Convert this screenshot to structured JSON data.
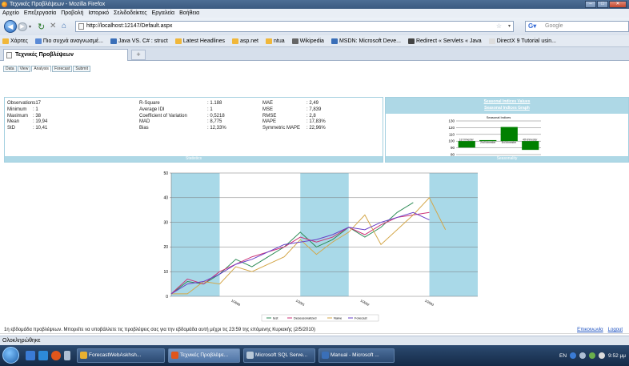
{
  "window": {
    "title": "Τεχνικές Προβλέψεων - Mozilla Firefox"
  },
  "menu": [
    "Αρχείο",
    "Επεξεργασία",
    "Προβολή",
    "Ιστορικό",
    "Σελιδοδείκτες",
    "Εργαλεία",
    "Βοήθεια"
  ],
  "nav": {
    "url": "http://localhost:12147/Default.aspx",
    "search_placeholder": "Google"
  },
  "bookmarks": [
    {
      "label": "Χάρτες",
      "color": "#f0b73a"
    },
    {
      "label": "Πιο συχνά αναγνωσμέ...",
      "color": "#5a8ad6"
    },
    {
      "label": "Java VS. C# : struct",
      "color": "#3a6fb8"
    },
    {
      "label": "Latest Headlines",
      "color": "#f0b73a"
    },
    {
      "label": "asp.net",
      "color": "#f0b73a"
    },
    {
      "label": "ntua",
      "color": "#f0b73a"
    },
    {
      "label": "Wikipedia",
      "color": "#666666"
    },
    {
      "label": "MSDN: Microsoft Deve...",
      "color": "#3a6fb8"
    },
    {
      "label": "Redirect « Servlets « Java",
      "color": "#444444"
    },
    {
      "label": "DirectX 9 Tutorial usin...",
      "color": "#dddddd"
    }
  ],
  "browser_tab": {
    "title": "Τεχνικές Προβλέψεων",
    "new_tab": "+"
  },
  "page_tabs": [
    "Data",
    "View",
    "Analysis",
    "Forecast",
    "Submit"
  ],
  "stats": {
    "col1": [
      {
        "k": "Observations",
        "v": ": 17"
      },
      {
        "k": "Minimum",
        "v": ": 1"
      },
      {
        "k": "Maximum",
        "v": ": 38"
      },
      {
        "k": "Mean",
        "v": ": 19,94"
      },
      {
        "k": "StD",
        "v": ": 10,41"
      }
    ],
    "col2": [
      {
        "k": "R-Square",
        "v": ": 1.188"
      },
      {
        "k": "Average IDI",
        "v": ": 1"
      },
      {
        "k": "Coefficient of Variation",
        "v": ": 0,5218"
      },
      {
        "k": "MAD",
        "v": ": 8,775"
      },
      {
        "k": "Bias",
        "v": ": 12,33%"
      }
    ],
    "col3": [
      {
        "k": "MAE",
        "v": ": 2,49"
      },
      {
        "k": "MSE",
        "v": ": 7,839"
      },
      {
        "k": "RMSE",
        "v": ": 2,8"
      },
      {
        "k": "MAPE",
        "v": ": 17,83%"
      },
      {
        "k": "Symmetric MAPE",
        "v": ": 22,96%"
      }
    ],
    "footer": "Statistics"
  },
  "seasonality": {
    "link1": "Seasonal Indices Values",
    "link2": "Seasonal Indices Graph",
    "footer": "Seasonality"
  },
  "chart_data": [
    {
      "type": "bar",
      "title": "Seasonal Indices",
      "categories": [
        "1st trimester",
        "2nd trimester",
        "3rd trimester",
        "4th trimester"
      ],
      "values": [
        90.5,
        101.5,
        121,
        87
      ],
      "ylim": [
        80,
        130
      ],
      "yticks": [
        80,
        90,
        100,
        110,
        120,
        130
      ],
      "baseline": 100,
      "bar_color": "#008000"
    },
    {
      "type": "line",
      "x": [
        1,
        2,
        3,
        4,
        5,
        6,
        7,
        8,
        9,
        10,
        11,
        12,
        13,
        14,
        15,
        16,
        17,
        18,
        19
      ],
      "ylim": [
        0,
        50
      ],
      "yticks": [
        0,
        10,
        20,
        30,
        40,
        50
      ],
      "xtick_labels": [
        "1/2000",
        "1/2001",
        "1/2002",
        "1/2003"
      ],
      "shaded_bands": [
        [
          1,
          4
        ],
        [
          9,
          12
        ],
        [
          17,
          20
        ]
      ],
      "series": [
        {
          "name": "test",
          "color": "#2e8b57",
          "values": [
            1,
            6,
            5,
            9,
            15,
            12,
            16,
            20,
            26,
            20,
            23,
            28,
            24,
            28,
            34,
            38,
            null,
            null,
            null
          ]
        },
        {
          "name": "Deseasonalized",
          "color": "#cc3377",
          "values": [
            1,
            7,
            5,
            10,
            13,
            16,
            18,
            20,
            24,
            22,
            24,
            28,
            25,
            29,
            32,
            33,
            34,
            null,
            null
          ]
        },
        {
          "name": "Naive",
          "color": "#d4a74a",
          "values": [
            1,
            1,
            6,
            5,
            12,
            10,
            13,
            16,
            23,
            17,
            22,
            26,
            33,
            21,
            27,
            33,
            40,
            27,
            null
          ]
        },
        {
          "name": "Forecast",
          "color": "#6a40c8",
          "values": [
            1,
            5,
            6,
            9,
            13,
            15,
            18,
            21,
            22,
            23,
            25,
            28,
            27,
            30,
            32,
            34,
            31,
            null,
            null
          ]
        }
      ]
    }
  ],
  "footer": {
    "message": "1η εβδομάδα προβλέψεων. Μπορείτε να υποβάλλετε τις προβλέψεις σας για την εβδομάδα αυτή μέχρι τις 23:59 της επόμενης Κυριακής (2/5/2010)",
    "contact": "Επικοινωνία",
    "logout": "Logout"
  },
  "statusbar": {
    "text": "Ολοκληρώθηκε"
  },
  "taskbar": {
    "tasks": [
      {
        "label": "ForecastWebAskhsh...",
        "color": "#e8b030",
        "active": false
      },
      {
        "label": "Τεχνικές Προβλέψε...",
        "color": "#e0561b",
        "active": true
      },
      {
        "label": "Microsoft SQL Serve...",
        "color": "#b8c8d8",
        "active": false
      },
      {
        "label": "Manual - Microsoft ...",
        "color": "#3a6fb8",
        "active": false
      }
    ],
    "lang": "EN",
    "time": "9:52 μμ"
  }
}
